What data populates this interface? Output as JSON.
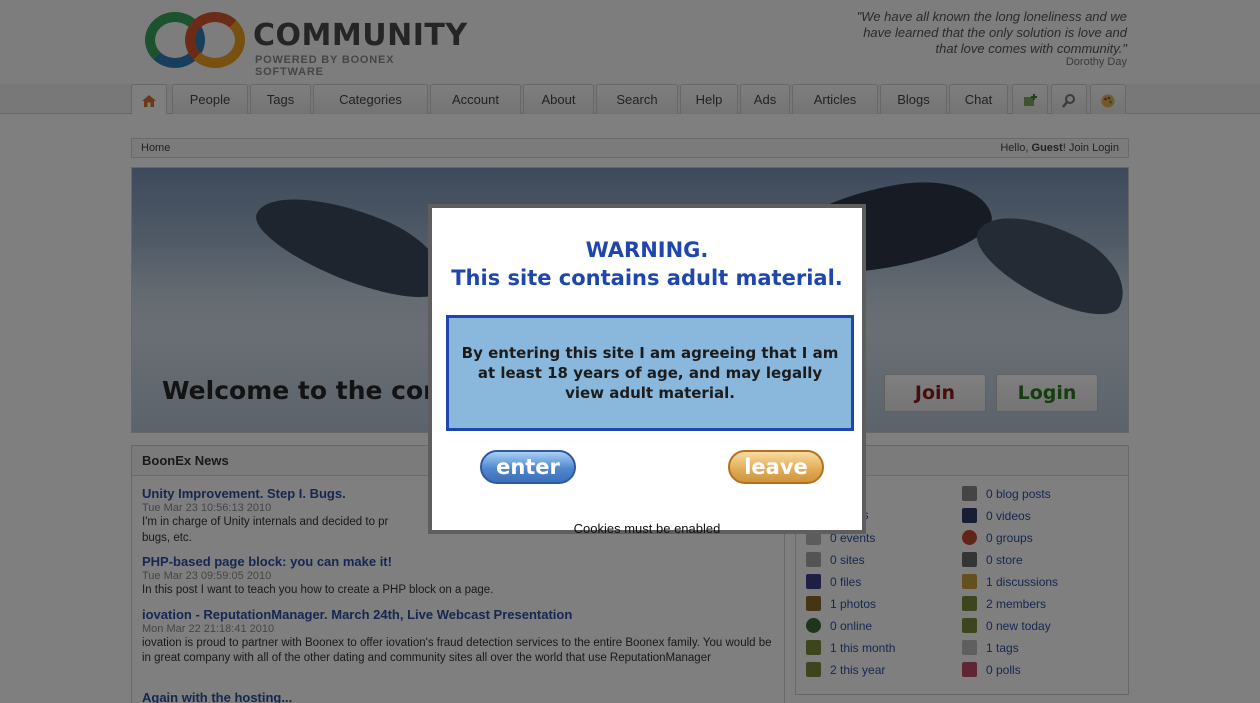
{
  "header": {
    "logo_title": "COMMUNITY",
    "logo_subtitle": "POWERED BY BOONEX SOFTWARE",
    "quote_lines": [
      "\"We have all known the long loneliness and we",
      "have learned that the only solution is love and",
      "that love comes with community.\""
    ],
    "quote_author": "Dorothy Day"
  },
  "nav": {
    "tabs": [
      {
        "label": "People"
      },
      {
        "label": "Tags"
      },
      {
        "label": "Categories"
      },
      {
        "label": "Account"
      },
      {
        "label": "About"
      },
      {
        "label": "Search"
      },
      {
        "label": "Help"
      },
      {
        "label": "Ads"
      },
      {
        "label": "Articles"
      },
      {
        "label": "Blogs"
      },
      {
        "label": "Chat"
      }
    ],
    "icons": [
      "home-icon",
      "add-icon",
      "magnifier-icon",
      "palette-icon"
    ]
  },
  "breadcrumb": {
    "home": "Home",
    "hello": "Hello,",
    "user": "Guest",
    "join": "! Join",
    "login": "Login"
  },
  "hero": {
    "welcome": "Welcome to the com",
    "join_label": "Join",
    "login_label": "Login"
  },
  "news": {
    "title": "BoonEx News",
    "items": [
      {
        "title": "Unity Improvement. Step I. Bugs.",
        "date": "Tue Mar 23 10:56:13 2010",
        "text": "I'm in charge of Unity internals and decided to pr",
        "text2": "bugs, etc."
      },
      {
        "title": "PHP-based page block: you can make it!",
        "date": "Tue Mar 23 09:59:05 2010",
        "text": "In this post I want to teach you how to create a PHP block on a page."
      },
      {
        "title": "iovation - ReputationManager. March 24th, Live Webcast Presentation",
        "date": "Mon Mar 22 21:18:41 2010",
        "text": "iovation is proud to partner with Boonex to offer iovation's fraud detection services to the entire Boonex family. You would be in great company with all of the other dating and community sites all over the world that use ReputationManager"
      },
      {
        "title": "Again with the hosting...",
        "date": "",
        "text": ""
      }
    ]
  },
  "stats": {
    "title_fragment": "s",
    "left": [
      {
        "label": "ds",
        "icon": "ads-icon"
      },
      {
        "label": "0 events",
        "icon": "events-icon"
      },
      {
        "label": "0 sites",
        "icon": "sites-icon"
      },
      {
        "label": "0 files",
        "icon": "files-icon"
      },
      {
        "label": "1 photos",
        "icon": "photos-icon"
      },
      {
        "label": "0 online",
        "icon": "online-icon"
      },
      {
        "label": "1 this month",
        "icon": "members-month-icon"
      },
      {
        "label": "2 this year",
        "icon": "members-year-icon"
      }
    ],
    "right": [
      {
        "label": "0 blog posts",
        "icon": "blog-icon"
      },
      {
        "label": "0 videos",
        "icon": "videos-icon"
      },
      {
        "label": "0 groups",
        "icon": "groups-icon"
      },
      {
        "label": "0 store",
        "icon": "store-icon"
      },
      {
        "label": "1 discussions",
        "icon": "discussions-icon"
      },
      {
        "label": "2 members",
        "icon": "members-icon"
      },
      {
        "label": "0 new today",
        "icon": "new-today-icon"
      },
      {
        "label": "1 tags",
        "icon": "tags-icon"
      },
      {
        "label": "0 polls",
        "icon": "polls-icon"
      }
    ]
  },
  "dialog": {
    "warning_line1": "WARNING.",
    "warning_line2": "This site contains adult material.",
    "agreement": "By entering this site I am agreeing that I am at least 18 years of age, and may legally view adult material.",
    "enter_label": "enter",
    "leave_label": "leave",
    "cookies_note": "Cookies must be enabled"
  }
}
